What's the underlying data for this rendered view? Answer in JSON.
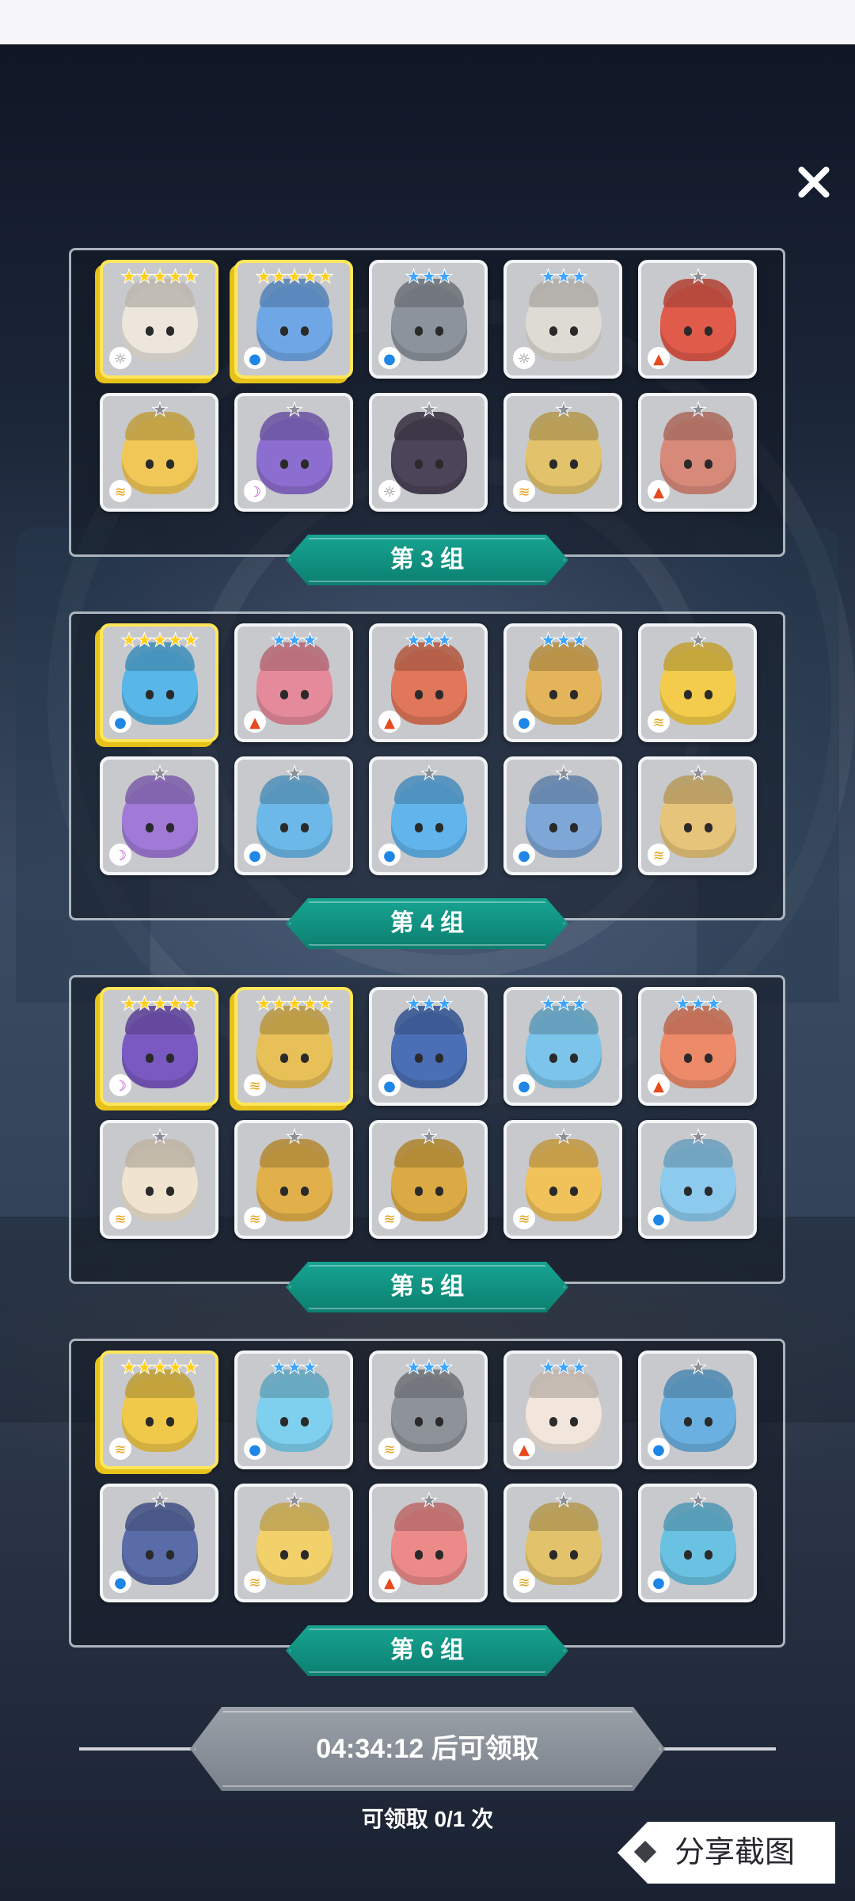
{
  "close_icon": "close-icon",
  "groups": [
    {
      "label": "第 3 组",
      "cards": [
        {
          "stars": "★★★★★",
          "rank": "gold",
          "element": "light",
          "color": "#ece6dc"
        },
        {
          "stars": "★★★★★",
          "rank": "gold",
          "element": "water",
          "color": "#6fa7e6"
        },
        {
          "stars": "★★★",
          "rank": "blue",
          "element": "water",
          "color": "#8d939c"
        },
        {
          "stars": "★★★",
          "rank": "blue",
          "element": "light",
          "color": "#dedbd4"
        },
        {
          "stars": "★",
          "rank": "gray",
          "element": "fire",
          "color": "#e05b4a"
        },
        {
          "stars": "★",
          "rank": "gray",
          "element": "wind",
          "color": "#f1c857"
        },
        {
          "stars": "★",
          "rank": "gray",
          "element": "dark",
          "color": "#8c6ed0"
        },
        {
          "stars": "★",
          "rank": "gray",
          "element": "light",
          "color": "#4c4458"
        },
        {
          "stars": "★",
          "rank": "gray",
          "element": "wind",
          "color": "#e2c26a"
        },
        {
          "stars": "★",
          "rank": "gray",
          "element": "fire",
          "color": "#d88a7a"
        }
      ]
    },
    {
      "label": "第 4 组",
      "cards": [
        {
          "stars": "★★★★★",
          "rank": "gold",
          "element": "water",
          "color": "#58b6e8"
        },
        {
          "stars": "★★★",
          "rank": "blue",
          "element": "fire",
          "color": "#e58a9a"
        },
        {
          "stars": "★★★",
          "rank": "blue",
          "element": "fire",
          "color": "#e0765a"
        },
        {
          "stars": "★★★",
          "rank": "blue",
          "element": "water",
          "color": "#e3b45a"
        },
        {
          "stars": "★",
          "rank": "gray",
          "element": "wind",
          "color": "#f2cc4a"
        },
        {
          "stars": "★",
          "rank": "gray",
          "element": "dark",
          "color": "#a07ad6"
        },
        {
          "stars": "★",
          "rank": "gray",
          "element": "water",
          "color": "#6cb8e8"
        },
        {
          "stars": "★",
          "rank": "gray",
          "element": "water",
          "color": "#62b4ec"
        },
        {
          "stars": "★",
          "rank": "gray",
          "element": "water",
          "color": "#7ea6d6"
        },
        {
          "stars": "★",
          "rank": "gray",
          "element": "wind",
          "color": "#e6c47a"
        }
      ]
    },
    {
      "label": "第 5 组",
      "cards": [
        {
          "stars": "★★★★★",
          "rank": "gold",
          "element": "dark",
          "color": "#7a5ac2"
        },
        {
          "stars": "★★★★★",
          "rank": "gold",
          "element": "wind",
          "color": "#e8c058"
        },
        {
          "stars": "★★★",
          "rank": "blue",
          "element": "water",
          "color": "#4a6fb6"
        },
        {
          "stars": "★★★",
          "rank": "blue",
          "element": "water",
          "color": "#7cc4ea"
        },
        {
          "stars": "★★★",
          "rank": "blue",
          "element": "fire",
          "color": "#ec8a6a"
        },
        {
          "stars": "★",
          "rank": "gray",
          "element": "wind",
          "color": "#f0e4d0"
        },
        {
          "stars": "★",
          "rank": "gray",
          "element": "wind",
          "color": "#e2b04a"
        },
        {
          "stars": "★",
          "rank": "gray",
          "element": "wind",
          "color": "#dcaa44"
        },
        {
          "stars": "★",
          "rank": "gray",
          "element": "wind",
          "color": "#f2c25a"
        },
        {
          "stars": "★",
          "rank": "gray",
          "element": "water",
          "color": "#8ccaee"
        }
      ]
    },
    {
      "label": "第 6 组",
      "cards": [
        {
          "stars": "★★★★★",
          "rank": "gold",
          "element": "wind",
          "color": "#f0c84a"
        },
        {
          "stars": "★★★",
          "rank": "blue",
          "element": "water",
          "color": "#7ed0ee"
        },
        {
          "stars": "★★★",
          "rank": "blue",
          "element": "wind",
          "color": "#8e939a"
        },
        {
          "stars": "★★★",
          "rank": "blue",
          "element": "fire",
          "color": "#f2e6dc"
        },
        {
          "stars": "★",
          "rank": "gray",
          "element": "water",
          "color": "#6ab0e0"
        },
        {
          "stars": "★",
          "rank": "gray",
          "element": "water",
          "color": "#5a6ca8"
        },
        {
          "stars": "★",
          "rank": "gray",
          "element": "wind",
          "color": "#f2d06a"
        },
        {
          "stars": "★",
          "rank": "gray",
          "element": "fire",
          "color": "#ec8a8a"
        },
        {
          "stars": "★",
          "rank": "gray",
          "element": "wind",
          "color": "#e2c26a"
        },
        {
          "stars": "★",
          "rank": "gray",
          "element": "water",
          "color": "#6ac2e2"
        }
      ]
    }
  ],
  "timer_button": {
    "label": "04:34:12 后可领取"
  },
  "claim_count": "可领取 0/1 次",
  "share_button": {
    "label": "分享截图",
    "icon": "diamond-icon"
  }
}
